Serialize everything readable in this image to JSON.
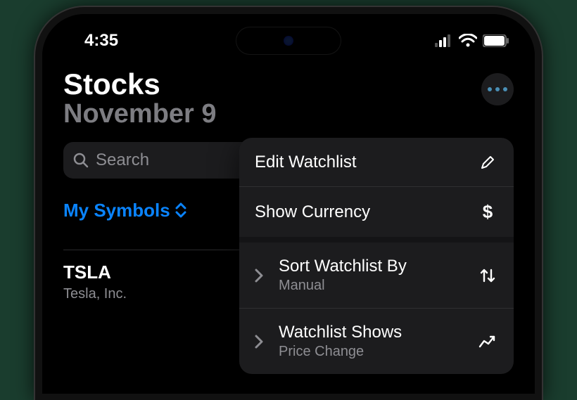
{
  "status": {
    "time": "4:35"
  },
  "header": {
    "title": "Stocks",
    "date": "November 9"
  },
  "search": {
    "placeholder": "Search"
  },
  "watchlistPicker": {
    "label": "My Symbols"
  },
  "rows": [
    {
      "symbol": "TSLA",
      "company": "Tesla, Inc."
    }
  ],
  "menu": {
    "edit": "Edit Watchlist",
    "currency": "Show Currency",
    "sort": {
      "label": "Sort Watchlist By",
      "value": "Manual"
    },
    "shows": {
      "label": "Watchlist Shows",
      "value": "Price Change"
    }
  }
}
